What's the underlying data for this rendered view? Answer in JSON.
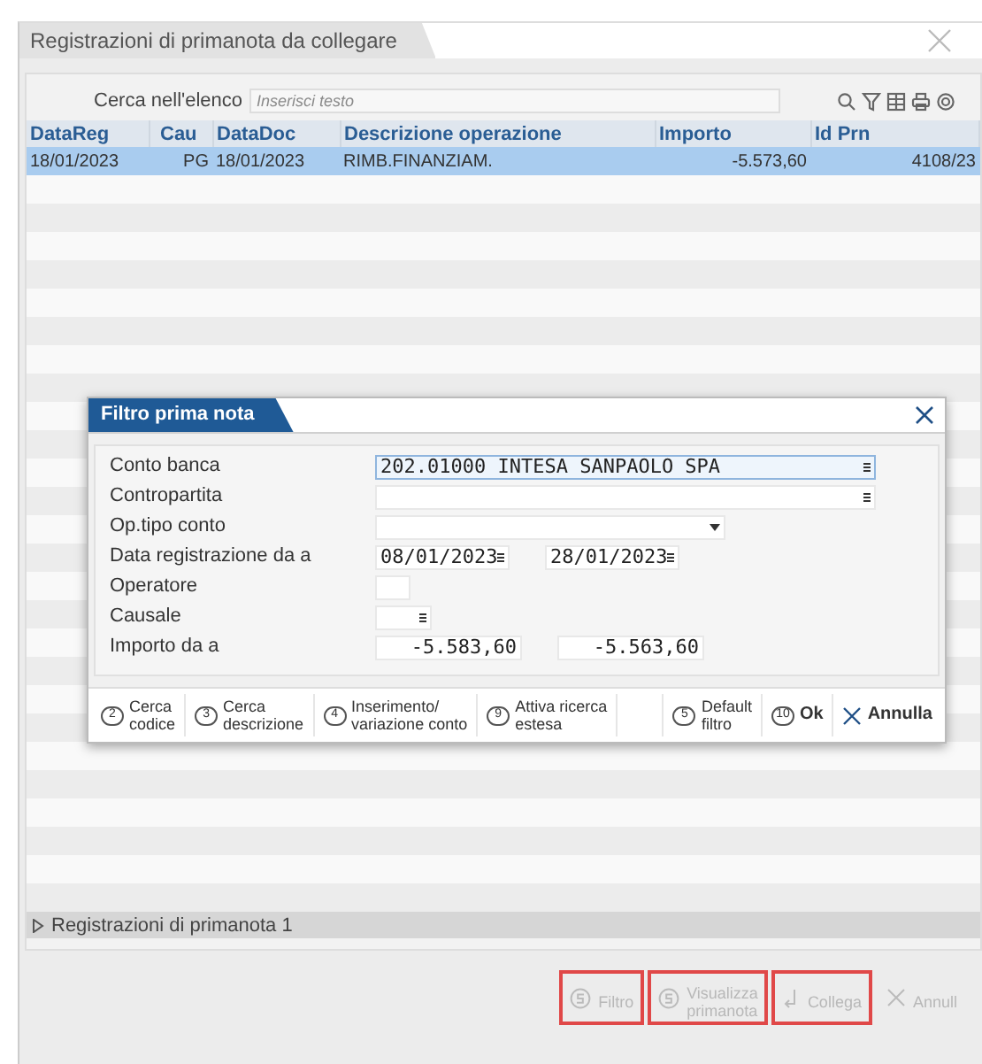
{
  "window": {
    "title": "Registrazioni di primanota da collegare"
  },
  "search": {
    "label": "Cerca nell'elenco",
    "placeholder": "Inserisci testo"
  },
  "table": {
    "columns": [
      "DataReg",
      "Cau",
      "DataDoc",
      "Descrizione operazione",
      "Importo",
      "Id Prn"
    ],
    "rows": [
      {
        "cells": [
          "18/01/2023",
          "PG",
          "18/01/2023",
          "RIMB.FINANZIAM.",
          "-5.573,60",
          "4108/23"
        ],
        "selected": true
      }
    ]
  },
  "filter_dialog": {
    "title": "Filtro prima nota",
    "fields": [
      {
        "label": "Conto banca",
        "kind": "lookup",
        "value": "202.01000 INTESA SANPAOLO SPA",
        "focused": true
      },
      {
        "label": "Contropartita",
        "kind": "lookup",
        "focused": false
      },
      {
        "label": "Op.tipo conto",
        "kind": "dropdown",
        "focused": false
      },
      {
        "label": "Data registrazione da a",
        "kind": "date_range",
        "values": [
          "08/01/2023",
          "28/01/2023"
        ],
        "focused": false
      },
      {
        "label": "Operatore",
        "kind": "short",
        "focused": false
      },
      {
        "label": "Causale",
        "kind": "short_lookup",
        "focused": false
      },
      {
        "label": "Importo da a",
        "kind": "range",
        "values": [
          "-5.583,60",
          "-5.563,60"
        ],
        "focused": false
      }
    ],
    "actions": [
      {
        "key": "2",
        "label": "Cerca\ncodice"
      },
      {
        "key": "3",
        "label": "Cerca\ndescrizione"
      },
      {
        "key": "4",
        "label": "Inserimento/\nvariazione conto"
      },
      {
        "key": "9",
        "label": "Attiva ricerca\nestesa"
      },
      {
        "kind": "spacer"
      },
      {
        "key": "5",
        "label": "Default\nfiltro"
      },
      {
        "key": "10",
        "label": "Ok"
      },
      {
        "kind": "cancel",
        "label": "Annulla"
      }
    ]
  },
  "section": {
    "label": "Registrazioni di primanota 1",
    "expanded": false
  },
  "bottom_buttons": [
    {
      "kind": "shortcut",
      "label": "Filtro",
      "disabled": true,
      "highlighted": true
    },
    {
      "kind": "shortcut",
      "label": "Visualizza\nprimanota",
      "disabled": true,
      "highlighted": true
    },
    {
      "kind": "link",
      "label": "Collega",
      "disabled": true,
      "highlighted": true
    },
    {
      "kind": "cancel",
      "label": "Annull",
      "disabled": true,
      "highlighted": false
    }
  ]
}
